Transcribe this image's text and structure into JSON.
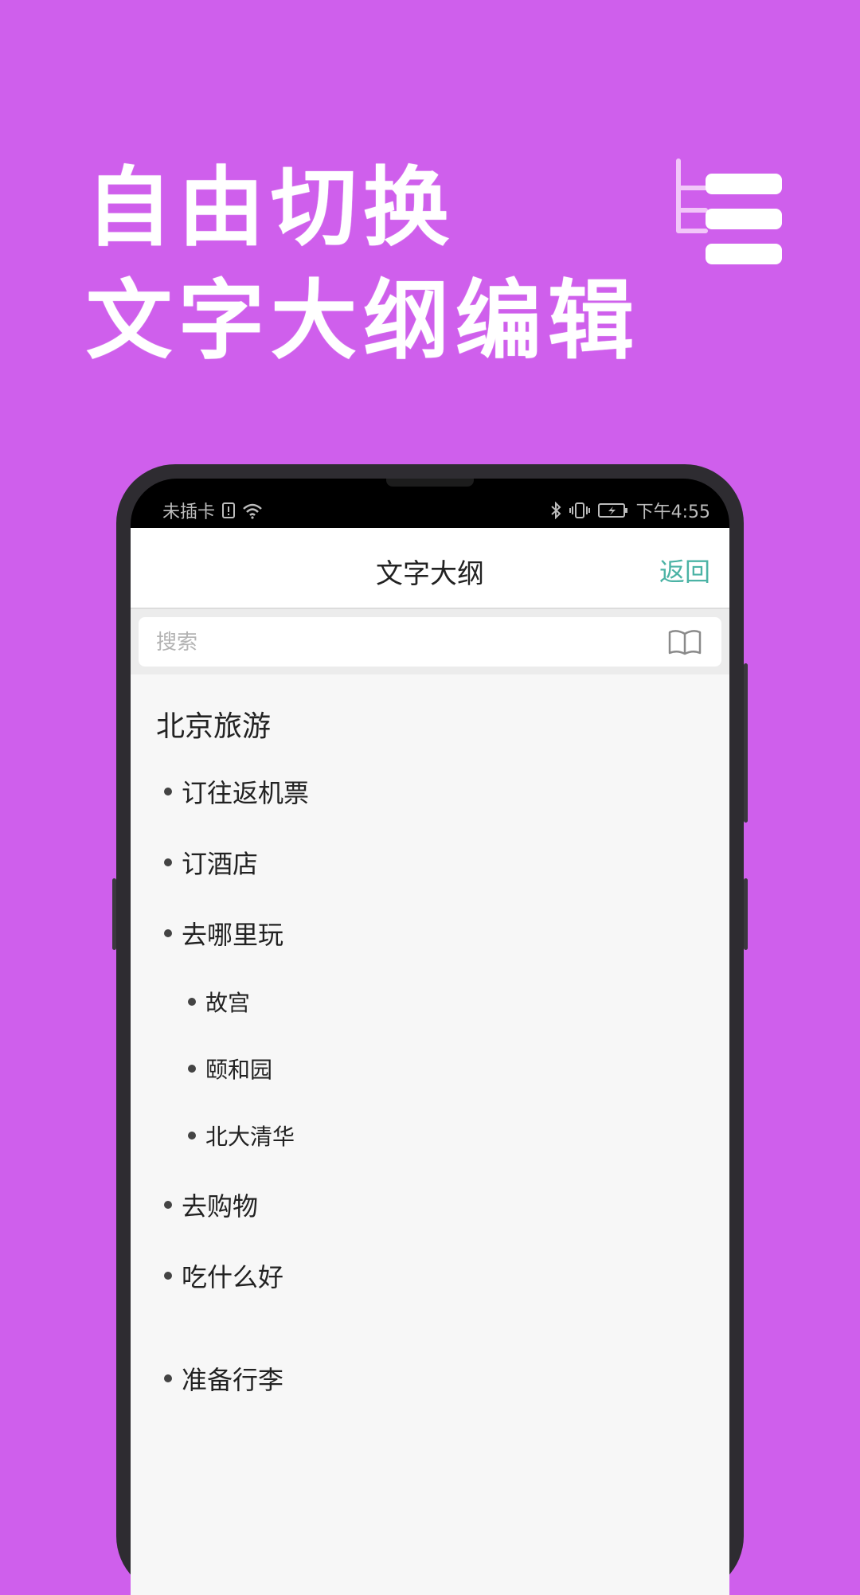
{
  "promo": {
    "line1": "自由切换",
    "line2": "文字大纲编辑",
    "logo_icon": "outline-tree-icon"
  },
  "status_bar": {
    "carrier": "未插卡",
    "icons_left": [
      "sim-alert-icon",
      "wifi-icon"
    ],
    "icons_right": [
      "bluetooth-icon",
      "vibrate-icon",
      "battery-charging-icon"
    ],
    "time": "下午4:55"
  },
  "header": {
    "title": "文字大纲",
    "back_label": "返回"
  },
  "search": {
    "placeholder": "搜索",
    "value": "",
    "icon": "book-icon"
  },
  "outline": {
    "title": "北京旅游",
    "items": [
      {
        "text": "订往返机票",
        "level": 1
      },
      {
        "text": "订酒店",
        "level": 1
      },
      {
        "text": "去哪里玩",
        "level": 1
      },
      {
        "text": "故宫",
        "level": 2
      },
      {
        "text": "颐和园",
        "level": 2
      },
      {
        "text": "北大清华",
        "level": 2
      },
      {
        "text": "去购物",
        "level": 1
      },
      {
        "text": "吃什么好",
        "level": 1
      },
      {
        "text": "准备行李",
        "level": 1
      }
    ]
  },
  "colors": {
    "background": "#cf5fec",
    "accent": "#4bb3a5",
    "phone_frame": "#2e2c31"
  }
}
